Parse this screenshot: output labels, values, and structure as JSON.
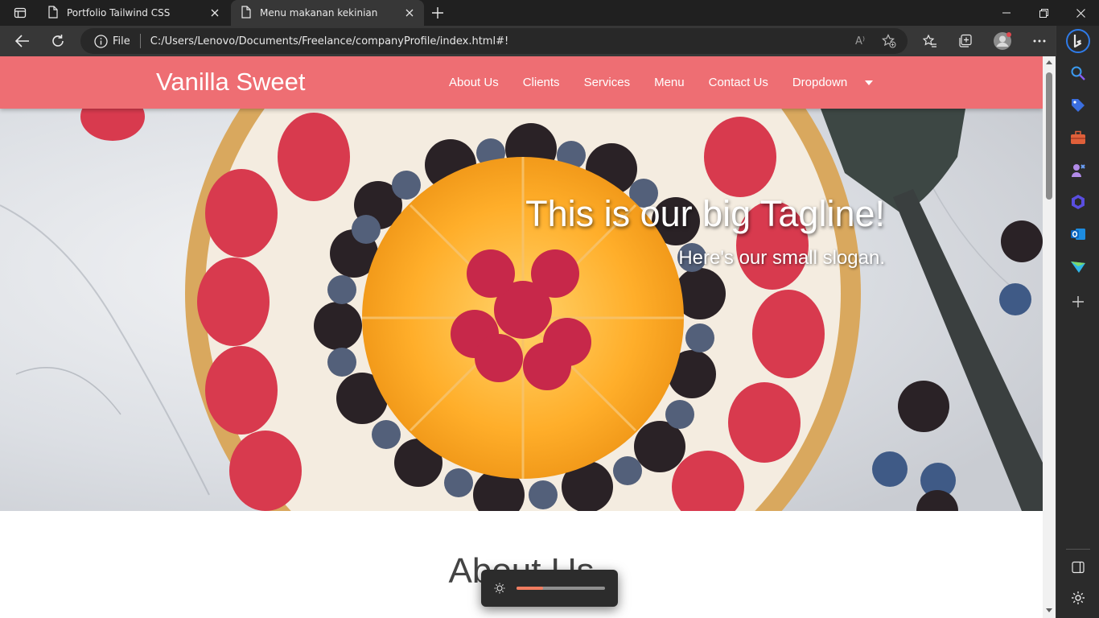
{
  "browser": {
    "tabs": [
      {
        "title": "Portfolio Tailwind CSS",
        "active": false
      },
      {
        "title": "Menu makanan kekinian",
        "active": true
      }
    ],
    "address": {
      "scheme_label": "File",
      "url": "C:/Users/Lenovo/Documents/Freelance/companyProfile/index.html#!"
    },
    "read_aloud_label": "A⁾"
  },
  "site": {
    "brand": "Vanilla Sweet",
    "nav": [
      "About Us",
      "Clients",
      "Services",
      "Menu",
      "Contact Us",
      "Dropdown"
    ],
    "tagline": "This is our big Tagline!",
    "slogan": "Here's our small slogan.",
    "section_title": "About Us"
  },
  "colors": {
    "navbar": "#ee6e73",
    "brightness_accent": "#f07c60"
  },
  "brightness": {
    "level": 0.3
  }
}
